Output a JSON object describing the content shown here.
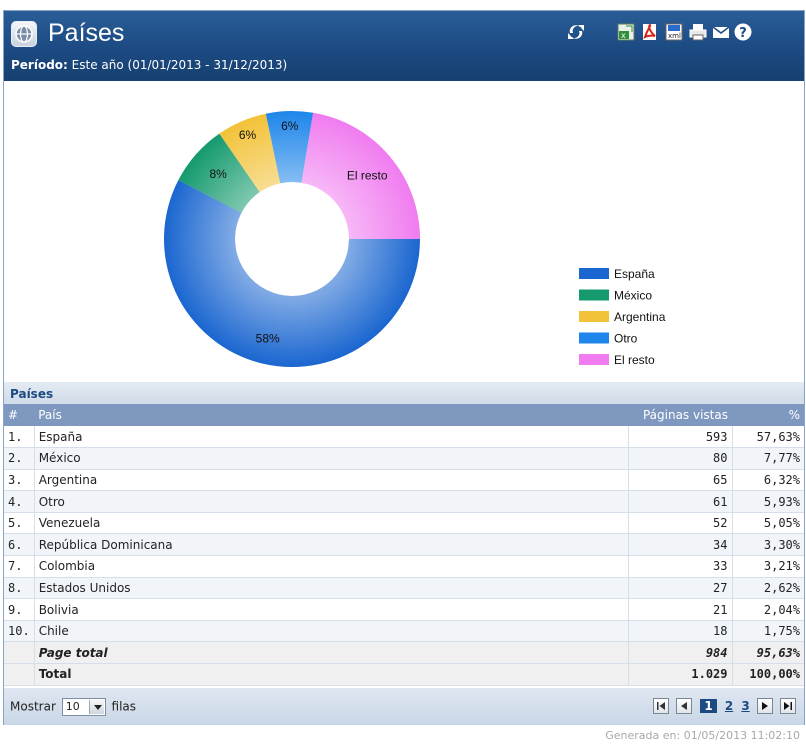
{
  "header": {
    "title": "Países",
    "period_label": "Período:",
    "period_value": "Este año (01/01/2013 - 31/12/2013)"
  },
  "toolbar": {
    "icons": [
      "refresh-icon",
      "excel-export-icon",
      "pdf-export-icon",
      "xml-export-icon",
      "print-icon",
      "email-icon",
      "help-icon"
    ]
  },
  "chart_data": {
    "type": "pie",
    "categories": [
      "España",
      "México",
      "Argentina",
      "Otro",
      "El resto"
    ],
    "values": [
      57.63,
      7.77,
      6.32,
      5.93,
      22.35
    ],
    "slice_labels": [
      "58%",
      "8%",
      "6%",
      "6%",
      "El resto"
    ],
    "colors": [
      "#1a66d0",
      "#149a6e",
      "#f2c238",
      "#1e86ea",
      "#f07cf0"
    ],
    "legend": [
      "España",
      "México",
      "Argentina",
      "Otro",
      "El resto"
    ],
    "legend_position": "bottom-right"
  },
  "table": {
    "section_title": "Países",
    "headers": {
      "num": "#",
      "country": "País",
      "views": "Páginas vistas",
      "pct": "%"
    },
    "rows": [
      {
        "num": "1.",
        "country": "España",
        "views": "593",
        "pct": "57,63%"
      },
      {
        "num": "2.",
        "country": "México",
        "views": "80",
        "pct": "7,77%"
      },
      {
        "num": "3.",
        "country": "Argentina",
        "views": "65",
        "pct": "6,32%"
      },
      {
        "num": "4.",
        "country": "Otro",
        "views": "61",
        "pct": "5,93%"
      },
      {
        "num": "5.",
        "country": "Venezuela",
        "views": "52",
        "pct": "5,05%"
      },
      {
        "num": "6.",
        "country": "República Dominicana",
        "views": "34",
        "pct": "3,30%"
      },
      {
        "num": "7.",
        "country": "Colombia",
        "views": "33",
        "pct": "3,21%"
      },
      {
        "num": "8.",
        "country": "Estados Unidos",
        "views": "27",
        "pct": "2,62%"
      },
      {
        "num": "9.",
        "country": "Bolivia",
        "views": "21",
        "pct": "2,04%"
      },
      {
        "num": "10.",
        "country": "Chile",
        "views": "18",
        "pct": "1,75%"
      }
    ],
    "page_total": {
      "label": "Page total",
      "views": "984",
      "pct": "95,63%"
    },
    "total": {
      "label": "Total",
      "views": "1.029",
      "pct": "100,00%"
    }
  },
  "footer": {
    "show_label": "Mostrar",
    "rows_value": "10",
    "rows_suffix": "filas",
    "pages": [
      "1",
      "2",
      "3"
    ],
    "current_page": "1"
  },
  "generated": "Generada en:  01/05/2013 11:02:10"
}
